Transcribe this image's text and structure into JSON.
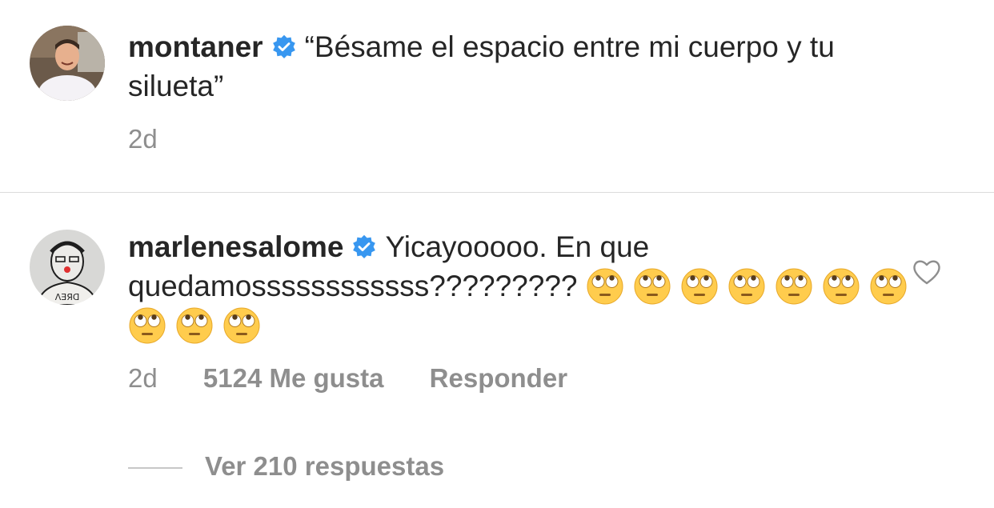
{
  "comments": [
    {
      "username": "montaner",
      "verified": true,
      "text": "“Bésame el espacio entre mi cuerpo y tu silueta”",
      "time": "2d",
      "avatar": "avatar-man-smiling"
    },
    {
      "username": "marlenesalome",
      "verified": true,
      "text": "Yicayooooo.  En que quedamossssssssssss?????????",
      "emoji": "face-with-rolling-eyes",
      "emoji_count": 10,
      "time": "2d",
      "likes": "5124 Me gusta",
      "reply_label": "Responder",
      "avatar": "avatar-sketch-drawing"
    }
  ],
  "view_replies_label": "Ver 210 respuestas",
  "colors": {
    "verified_blue": "#3897f0",
    "meta_gray": "#8e8e8e",
    "text": "#262626",
    "emoji_yellow": "#ffcc4d"
  }
}
